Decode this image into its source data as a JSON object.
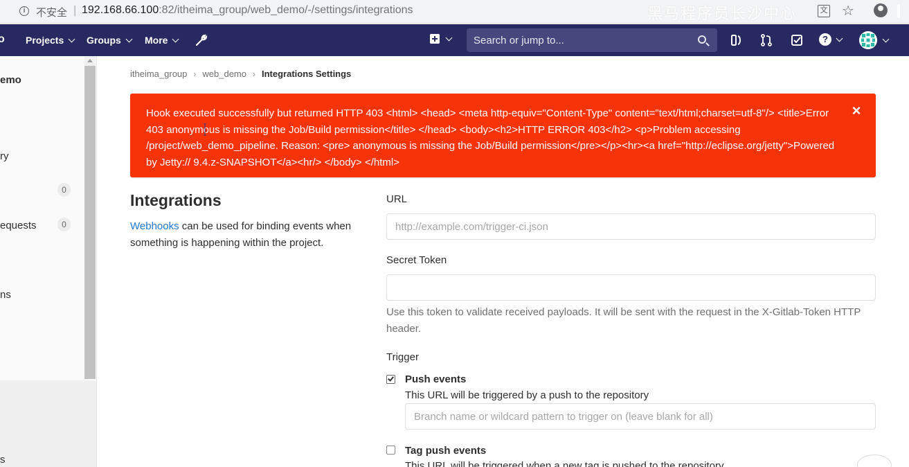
{
  "browser": {
    "insecure_label": "不安全",
    "separator": "|",
    "url_host": "192.168.66.100",
    "url_path": ":82/itheima_group/web_demo/-/settings/integrations",
    "watermark": "黑马程序员长沙中心"
  },
  "navbar": {
    "logo_fragment": "o",
    "projects_label": "Projects",
    "groups_label": "Groups",
    "more_label": "More",
    "search_placeholder": "Search or jump to...",
    "help_glyph": "?"
  },
  "sidebar": {
    "project_name_fragment": "emo",
    "item_repository_fragment": "ry",
    "issues_count": "0",
    "merge_requests_fragment": "equests",
    "merge_requests_count": "0",
    "operations_fragment": "ns",
    "bottom_fragment": "s"
  },
  "breadcrumb": {
    "group": "itheima_group",
    "project": "web_demo",
    "current": "Integrations Settings"
  },
  "flash": {
    "message": "Hook executed successfully but returned HTTP 403 <html> <head> <meta http-equiv=\"Content-Type\" content=\"text/html;charset=utf-8\"/> <title>Error 403 anonymous is missing the Job/Build permission</title> </head> <body><h2>HTTP ERROR 403</h2> <p>Problem accessing /project/web_demo_pipeline. Reason: <pre> anonymous is missing the Job/Build permission</pre></p><hr><a href=\"http://eclipse.org/jetty\">Powered by Jetty:// 9.4.z-SNAPSHOT</a><hr/> </body> </html>",
    "close_glyph": "×",
    "color": "#f7330a"
  },
  "integrations": {
    "title": "Integrations",
    "webhooks_link": "Webhooks",
    "description_rest": " can be used for binding events when something is happening within the project."
  },
  "form": {
    "url_label": "URL",
    "url_placeholder": "http://example.com/trigger-ci.json",
    "url_value": "",
    "secret_label": "Secret Token",
    "secret_value": "",
    "secret_help": "Use this token to validate received payloads. It will be sent with the request in the X-Gitlab-Token HTTP header.",
    "trigger_label": "Trigger",
    "push_events_label": "Push events",
    "push_events_checked": true,
    "push_events_desc": "This URL will be triggered by a push to the repository",
    "branch_placeholder": "Branch name or wildcard pattern to trigger on (leave blank for all)",
    "tag_push_label": "Tag push events",
    "tag_push_checked": false,
    "tag_push_desc": "This URL will be triggered when a new tag is pushed to the repository"
  },
  "colors": {
    "navbar": "#292961",
    "link": "#1f78d1",
    "flash_error": "#f7330a"
  }
}
